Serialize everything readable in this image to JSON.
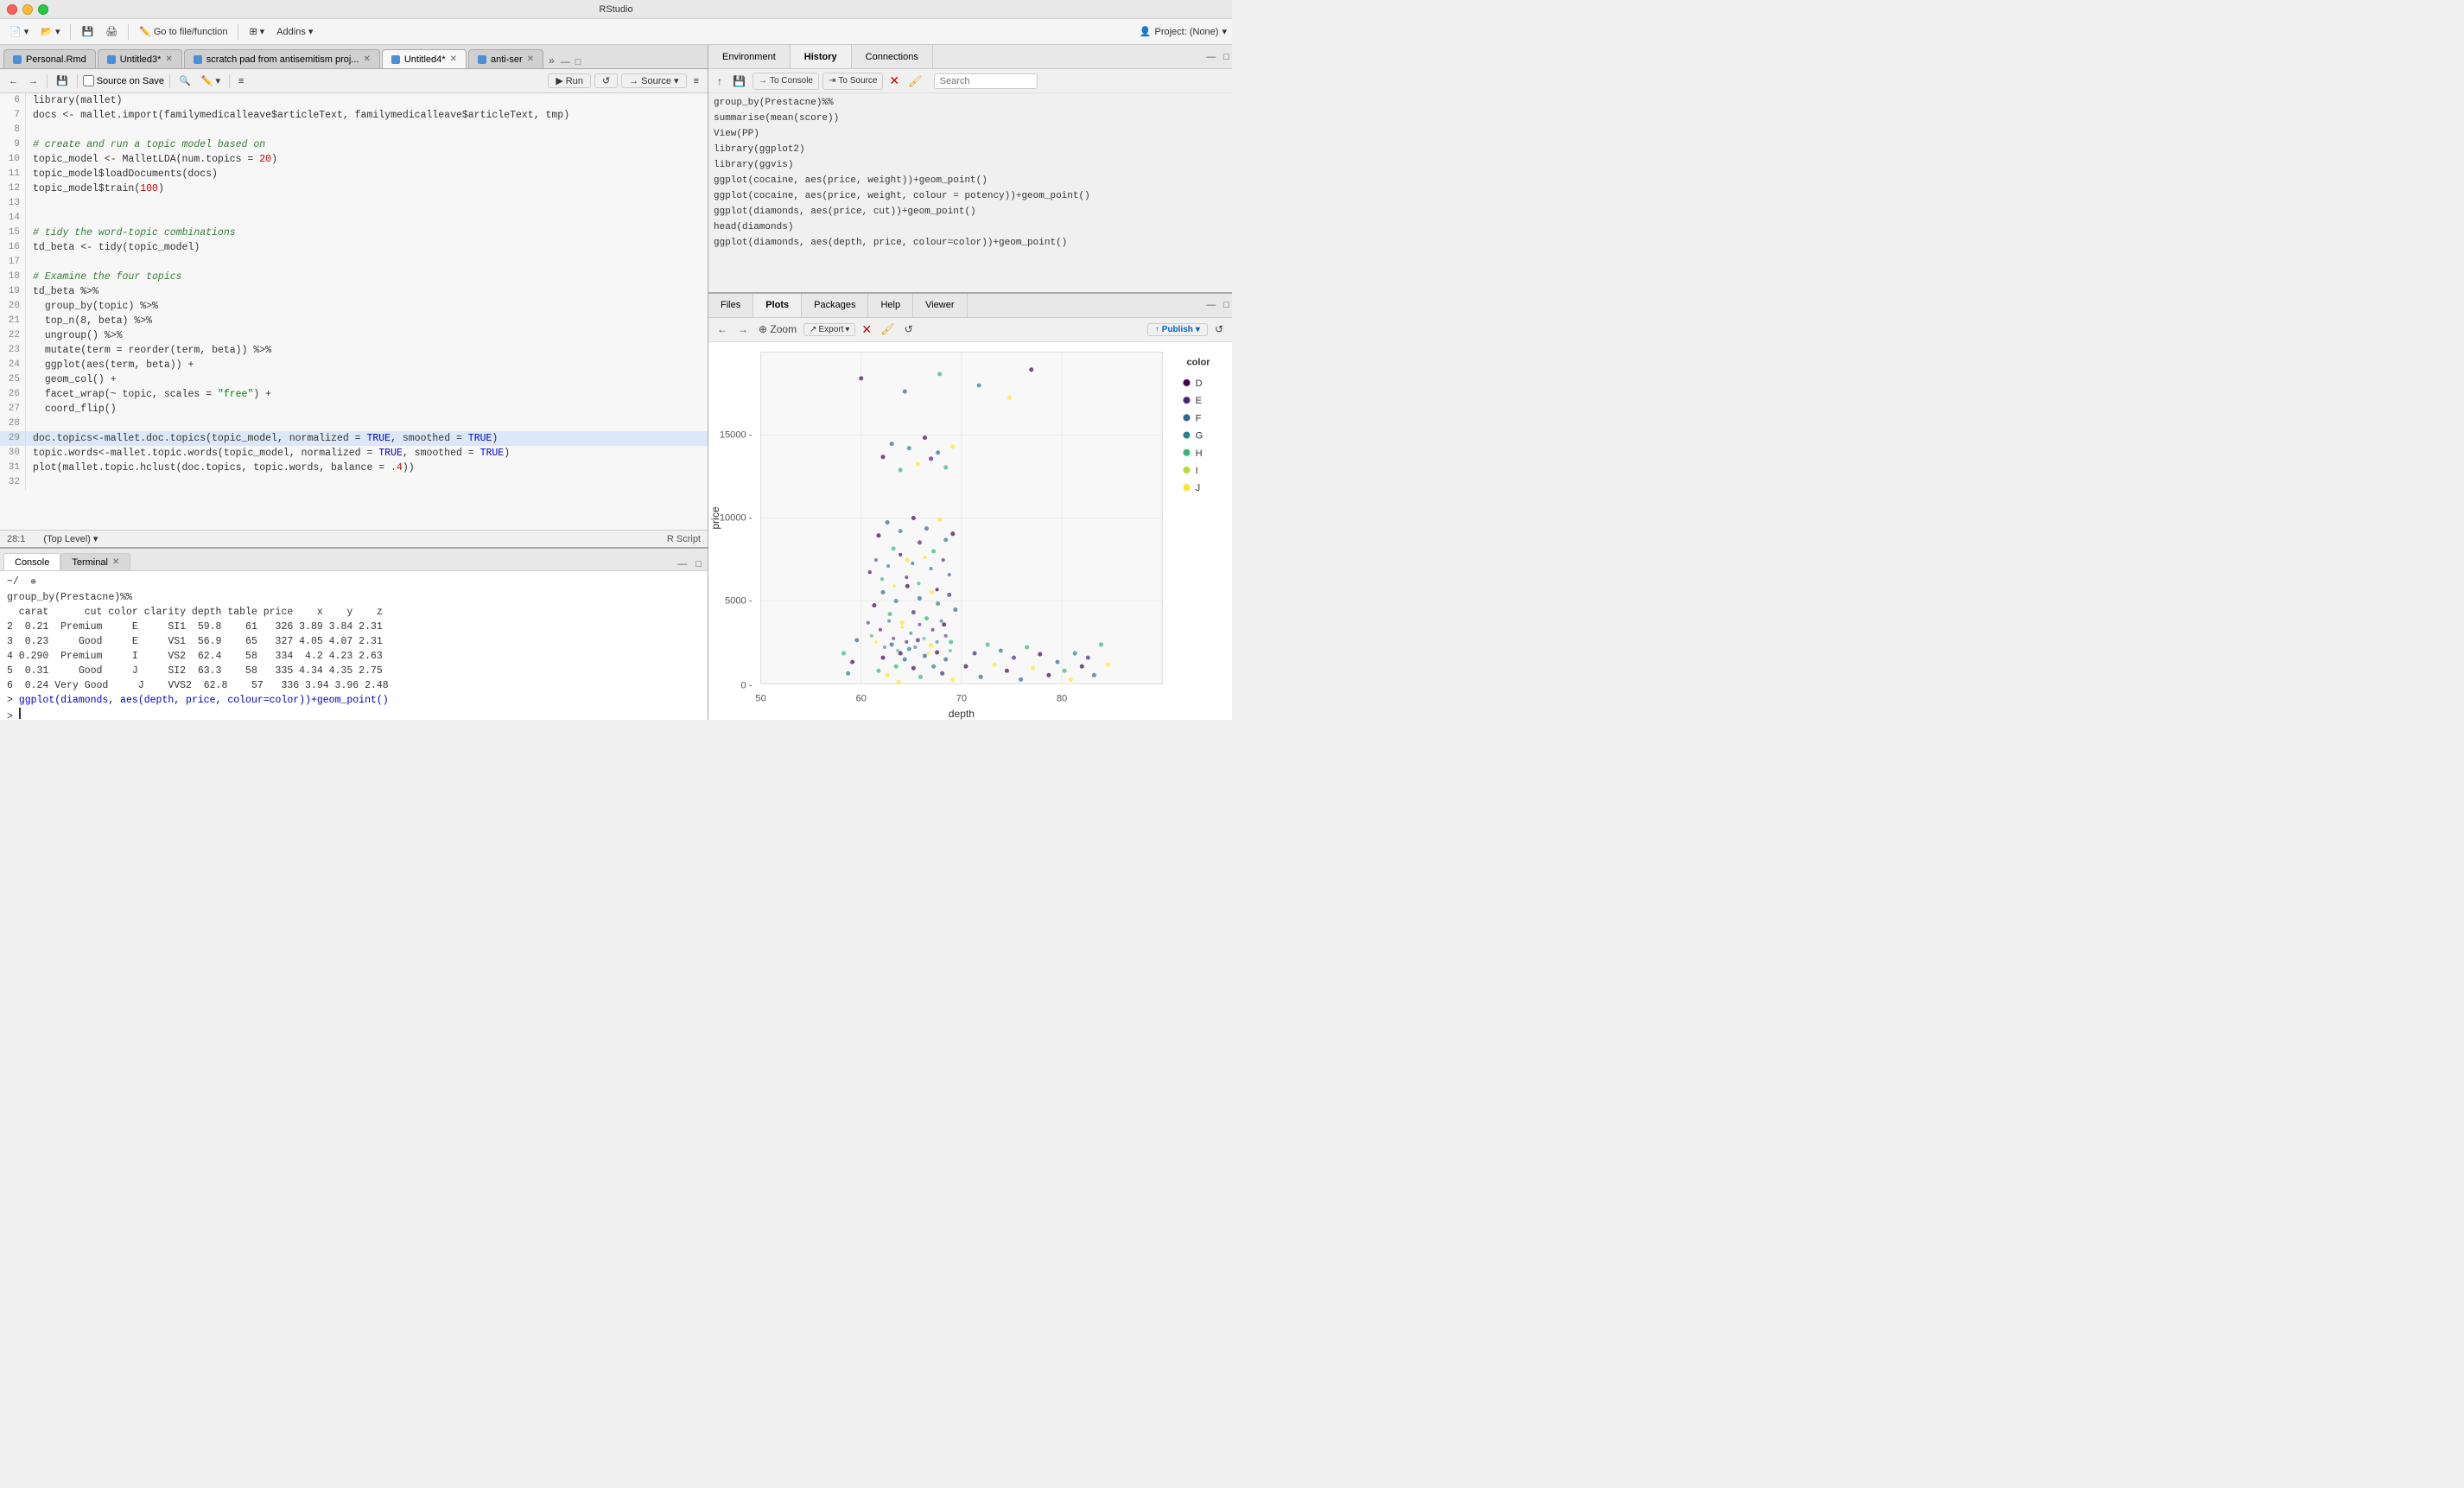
{
  "titleBar": {
    "title": "RStudio"
  },
  "toolbar": {
    "newFile": "New File",
    "openFile": "Open File",
    "save": "Save",
    "saveAll": "Save All",
    "goToFile": "Go to file/function",
    "addins": "Addins",
    "project": "Project: (None)"
  },
  "tabs": [
    {
      "label": "Personal.Rmd",
      "active": false,
      "icon": "rmd"
    },
    {
      "label": "Untitled3*",
      "active": false,
      "icon": "r",
      "closeable": true
    },
    {
      "label": "scratch pad from antisemitism proj...",
      "active": false,
      "icon": "r",
      "closeable": true
    },
    {
      "label": "Untitled4*",
      "active": true,
      "icon": "r",
      "closeable": true
    },
    {
      "label": "anti-ser",
      "active": false,
      "icon": "r",
      "closeable": true
    }
  ],
  "editorToolbar": {
    "sourceOnSave": "Source on Save",
    "run": "Run",
    "rerun": "Re-run",
    "source": "Source",
    "formatDoc": "Format Document"
  },
  "codeLines": [
    {
      "num": 6,
      "content": "library(mallet)",
      "type": "normal"
    },
    {
      "num": 7,
      "content": "docs <- mallet.import(familymedicalleave$articleText, familymedicalleave$articleText, tmp)",
      "type": "normal"
    },
    {
      "num": 8,
      "content": "",
      "type": "normal"
    },
    {
      "num": 9,
      "content": "# create and run a topic model based on",
      "type": "comment"
    },
    {
      "num": 10,
      "content": "topic_model <- MalletLDA(num.topics = 20)",
      "type": "normal"
    },
    {
      "num": 11,
      "content": "topic_model$loadDocuments(docs)",
      "type": "normal"
    },
    {
      "num": 12,
      "content": "topic_model$train(100)",
      "type": "normal"
    },
    {
      "num": 13,
      "content": "",
      "type": "normal"
    },
    {
      "num": 14,
      "content": "",
      "type": "normal"
    },
    {
      "num": 15,
      "content": "# tidy the word-topic combinations",
      "type": "comment"
    },
    {
      "num": 16,
      "content": "td_beta <- tidy(topic_model)",
      "type": "normal"
    },
    {
      "num": 17,
      "content": "",
      "type": "normal"
    },
    {
      "num": 18,
      "content": "# Examine the four topics",
      "type": "comment"
    },
    {
      "num": 19,
      "content": "td_beta %>%",
      "type": "normal"
    },
    {
      "num": 20,
      "content": "  group_by(topic) %>%",
      "type": "normal"
    },
    {
      "num": 21,
      "content": "  top_n(8, beta) %>%",
      "type": "normal"
    },
    {
      "num": 22,
      "content": "  ungroup() %>%",
      "type": "normal"
    },
    {
      "num": 23,
      "content": "  mutate(term = reorder(term, beta)) %>%",
      "type": "normal"
    },
    {
      "num": 24,
      "content": "  ggplot(aes(term, beta)) +",
      "type": "normal"
    },
    {
      "num": 25,
      "content": "  geom_col() +",
      "type": "normal"
    },
    {
      "num": 26,
      "content": "  facet_wrap(~ topic, scales = \"free\") +",
      "type": "normal"
    },
    {
      "num": 27,
      "content": "  coord_flip()",
      "type": "normal"
    },
    {
      "num": 28,
      "content": "",
      "type": "normal"
    },
    {
      "num": 29,
      "content": "doc.topics<-mallet.doc.topics(topic_model, normalized = TRUE, smoothed = TRUE)",
      "type": "highlighted"
    },
    {
      "num": 30,
      "content": "topic.words<-mallet.topic.words(topic_model, normalized = TRUE, smoothed = TRUE)",
      "type": "normal"
    },
    {
      "num": 31,
      "content": "plot(mallet.topic.hclust(doc.topics, topic.words, balance = .4))",
      "type": "normal"
    },
    {
      "num": 32,
      "content": "",
      "type": "normal"
    }
  ],
  "statusBar": {
    "position": "28:1",
    "level": "(Top Level)",
    "scriptType": "R Script"
  },
  "consoleTabs": [
    {
      "label": "Console",
      "active": true
    },
    {
      "label": "Terminal",
      "active": false,
      "closeable": true
    }
  ],
  "consoleLines": [
    "~/",
    "group_by(Prestacne)%%",
    "summarise(mean(score))",
    "View(PP)",
    "library(ggplot2)",
    "library(ggvis)",
    "ggplot(cocaine, aes(price, weight))+geom_point()",
    "ggplot(cocaine, aes(price, weight, colour = potency))+geom_point()",
    "ggplot(diamonds, aes(price, cut))+geom_point()",
    "head(diamonds)",
    "ggplot(diamonds, aes(depth, price, colour=color))+geom_point()"
  ],
  "dataLines": [
    {
      "num": "2",
      "cols": [
        "0.21",
        "Premium",
        "E",
        "SI1",
        "59.8",
        "61",
        "326",
        "3.89",
        "3.84",
        "2.31"
      ]
    },
    {
      "num": "3",
      "cols": [
        "0.23",
        "Good",
        "E",
        "VS1",
        "56.9",
        "65",
        "327",
        "4.05",
        "4.07",
        "2.31"
      ]
    },
    {
      "num": "4",
      "cols": [
        "0.290",
        "Premium",
        "I",
        "VS2",
        "62.4",
        "58",
        "334",
        "4.2",
        "4.23",
        "2.63"
      ]
    },
    {
      "num": "5",
      "cols": [
        "0.31",
        "Good",
        "J",
        "SI2",
        "63.3",
        "58",
        "335",
        "4.34",
        "4.35",
        "2.75"
      ]
    },
    {
      "num": "6",
      "cols": [
        "0.24",
        "Very Good",
        "J",
        "VVS2",
        "62.8",
        "57",
        "336",
        "3.94",
        "3.96",
        "2.48"
      ]
    }
  ],
  "consolePromptLine": "> ggplot(diamonds, aes(depth, price, colour=color))+geom_point()",
  "envTabs": [
    {
      "label": "Environment",
      "active": true
    },
    {
      "label": "History",
      "active": false
    },
    {
      "label": "Connections",
      "active": false
    }
  ],
  "envToolbar": {
    "toConsole": "To Console",
    "toSource": "To Source"
  },
  "historyLines": [
    "group_by(Prestacne)%%",
    "summarise(mean(score))",
    "View(PP)",
    "library(ggplot2)",
    "library(ggvis)",
    "ggplot(cocaine, aes(price, weight))+geom_point()",
    "ggplot(cocaine, aes(price, weight, colour = potency))+geom_point()",
    "ggplot(diamonds, aes(price, cut))+geom_point()",
    "head(diamonds)",
    "ggplot(diamonds, aes(depth, price, colour=color))+geom_point()"
  ],
  "filesTabs": [
    {
      "label": "Files",
      "active": false
    },
    {
      "label": "Plots",
      "active": true
    },
    {
      "label": "Packages",
      "active": false
    },
    {
      "label": "Help",
      "active": false
    },
    {
      "label": "Viewer",
      "active": false
    }
  ],
  "plotToolbar": {
    "zoom": "Zoom",
    "export": "Export",
    "publish": "Publish"
  },
  "plot": {
    "xLabel": "depth",
    "yLabel": "price",
    "title": "",
    "legend": {
      "title": "color",
      "items": [
        "D",
        "E",
        "F",
        "G",
        "H",
        "I",
        "J"
      ]
    },
    "xTicks": [
      "50",
      "60",
      "70",
      "80"
    ],
    "yTicks": [
      "0",
      "5000",
      "10000",
      "15000"
    ]
  },
  "icons": {
    "run": "▶",
    "rerun": "↺",
    "source": "→",
    "back": "←",
    "forward": "→",
    "zoom": "⊕",
    "save": "💾",
    "publish": "↑",
    "toConsole": "→",
    "toSource": "⇥",
    "close": "✕",
    "brush": "🖌",
    "minimize": "—",
    "maximize": "□",
    "chevronDown": "▾"
  }
}
